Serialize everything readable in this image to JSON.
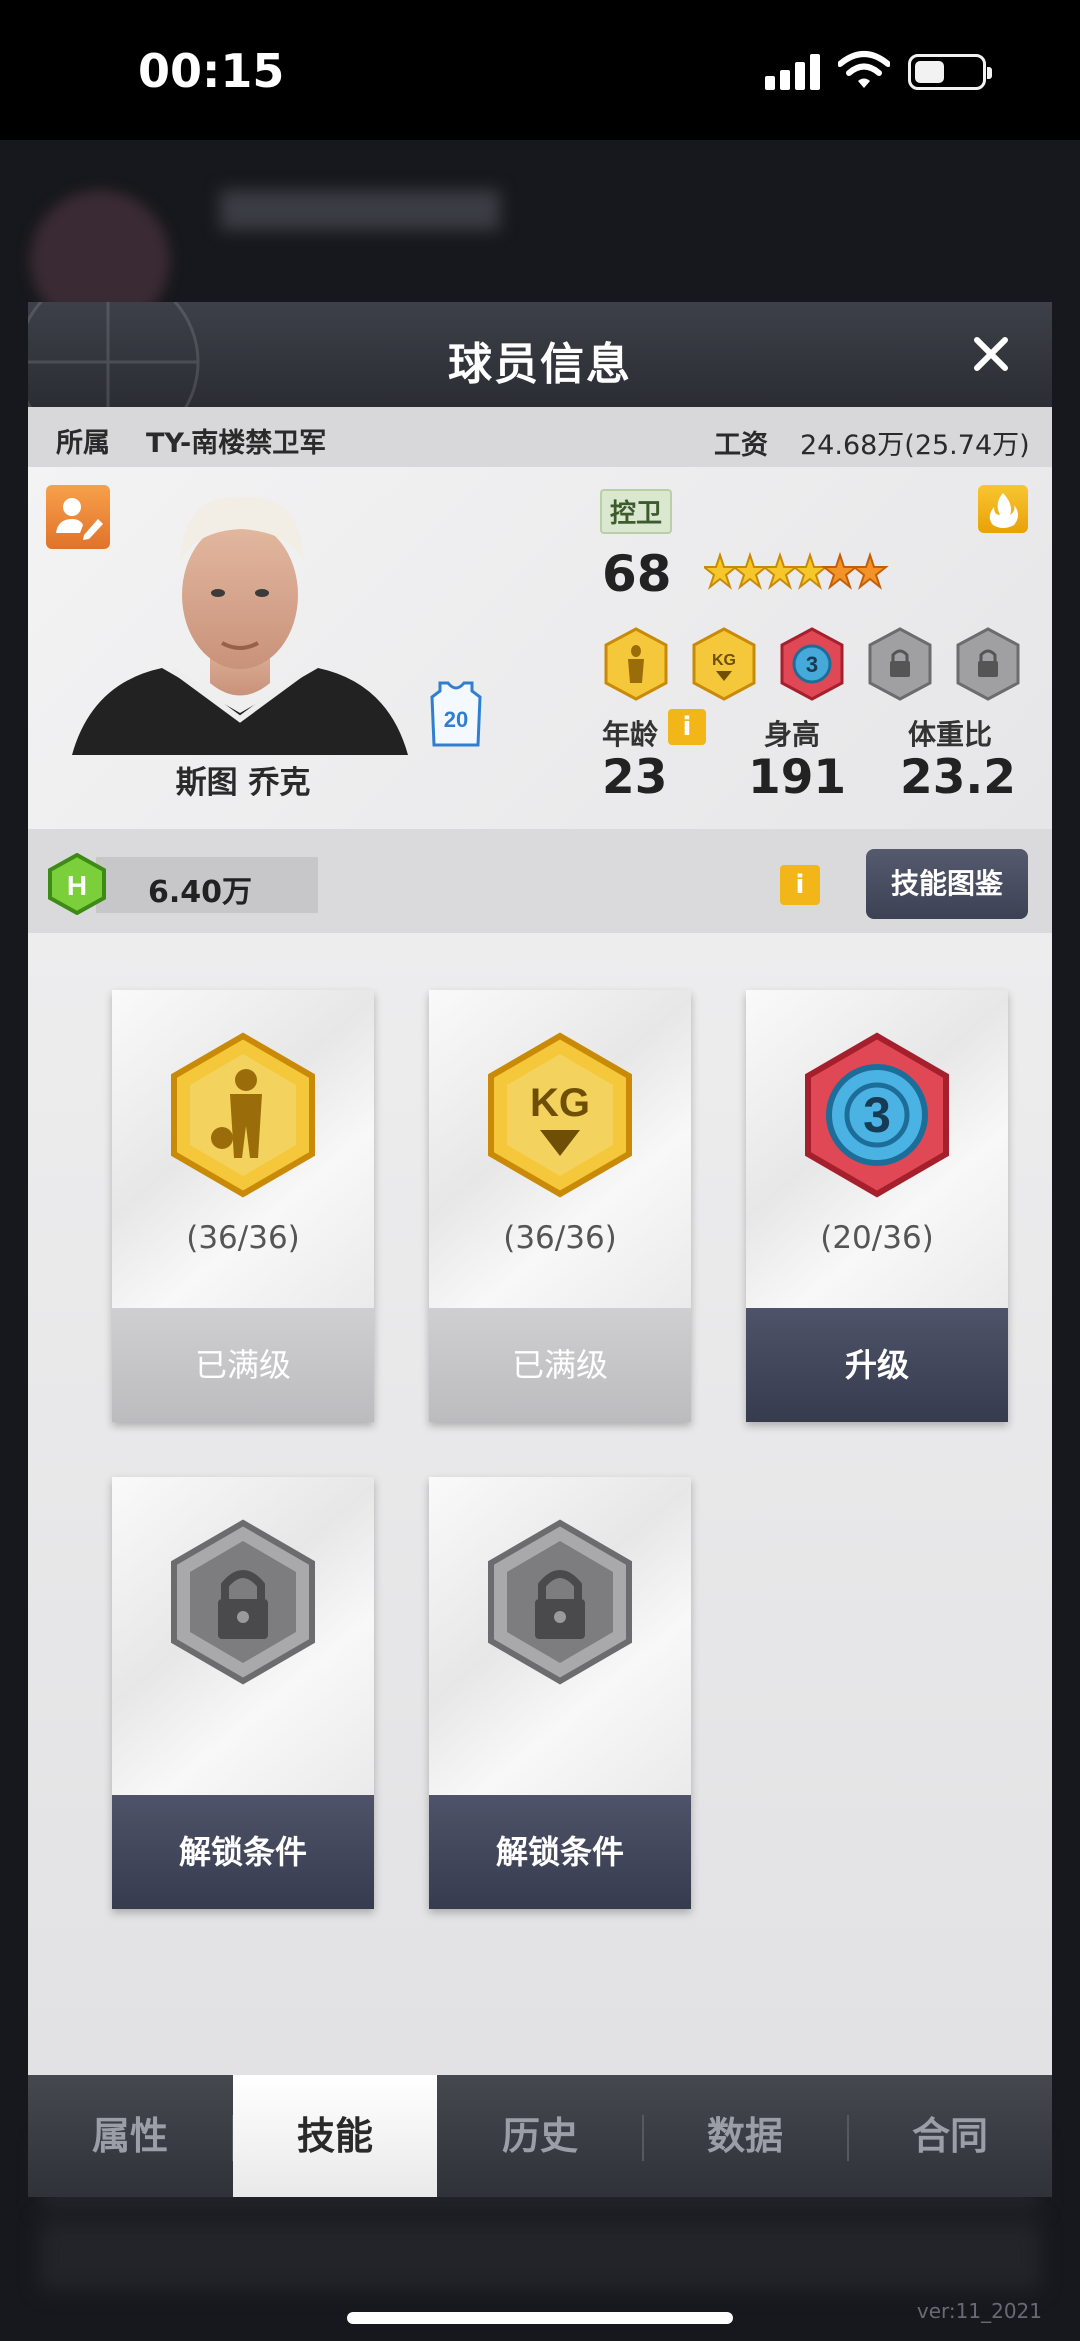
{
  "status_bar": {
    "time": "00:15",
    "battery_level": 0.45
  },
  "dialog": {
    "title": "球员信息",
    "close_icon": "close-icon"
  },
  "team": {
    "label": "所属",
    "name": "TY-南楼禁卫军",
    "salary_label": "工资",
    "salary_value": "24.68万(25.74万)"
  },
  "player": {
    "name": "斯图 乔克",
    "jersey_number": "20",
    "position": "控卫",
    "rating": "68",
    "stars": 6,
    "stats": [
      {
        "label": "年龄",
        "value": "23"
      },
      {
        "label": "身高",
        "value": "191"
      },
      {
        "label": "体重比",
        "value": "23.2"
      }
    ],
    "skill_icons": [
      "basketball-player-skill-icon",
      "kg-skill-icon",
      "three-point-skill-icon",
      "locked-skill-icon",
      "locked-skill-icon"
    ]
  },
  "funds": {
    "value": "6.40万",
    "info": "i",
    "guide_label": "技能图鉴"
  },
  "skills": [
    {
      "icon": "basketball-player-skill-icon",
      "progress": "(36/36)",
      "button": "已满级",
      "state": "maxed"
    },
    {
      "icon": "kg-skill-icon",
      "progress": "(36/36)",
      "button": "已满级",
      "state": "maxed"
    },
    {
      "icon": "three-point-skill-icon",
      "progress": "(20/36)",
      "button": "升级",
      "state": "upgrade"
    },
    {
      "icon": "locked-skill-icon",
      "progress": "",
      "button": "解锁条件",
      "state": "locked"
    },
    {
      "icon": "locked-skill-icon",
      "progress": "",
      "button": "解锁条件",
      "state": "locked"
    }
  ],
  "tabs": [
    {
      "label": "属性",
      "active": false
    },
    {
      "label": "技能",
      "active": true
    },
    {
      "label": "历史",
      "active": false
    },
    {
      "label": "数据",
      "active": false
    },
    {
      "label": "合同",
      "active": false
    }
  ],
  "version": "ver:11_2021",
  "colors": {
    "accent_gold": "#f2b618",
    "dark_button": "#3d4154",
    "panel_bg": "#ececed"
  }
}
